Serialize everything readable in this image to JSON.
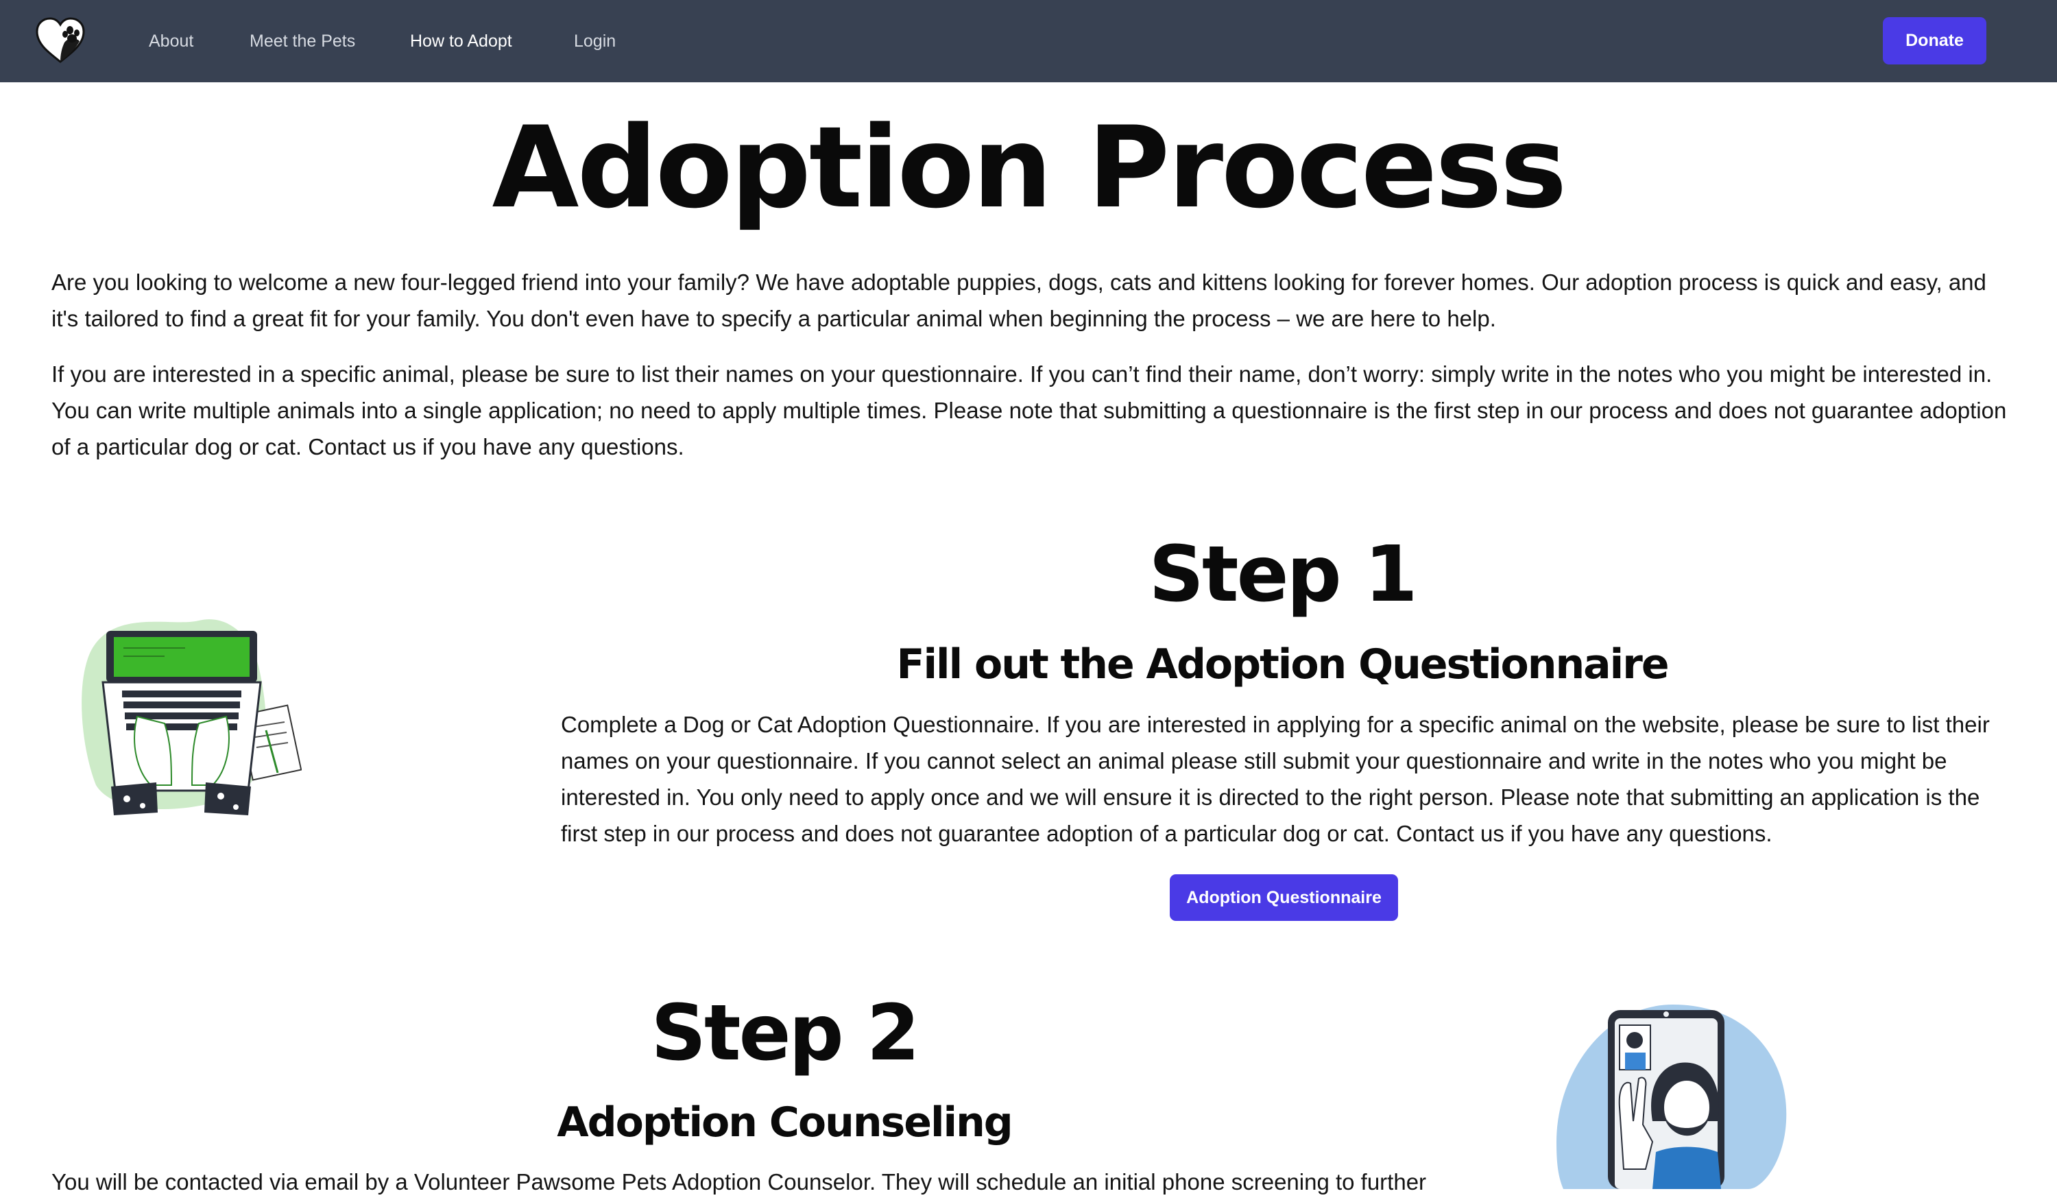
{
  "nav": {
    "logo_icon": "heart-paw-logo-icon",
    "links": [
      "About",
      "Meet the Pets",
      "How to Adopt",
      "Login"
    ],
    "active": "How to Adopt",
    "donate_label": "Donate"
  },
  "page": {
    "title": "Adoption Process",
    "intro_paragraphs": [
      "Are you looking to welcome a new four-legged friend into your family? We have adoptable puppies, dogs, cats and kittens looking for forever homes. Our adoption process is quick and easy, and it's tailored to find a great fit for your family. You don't even have to specify a particular animal when beginning the process – we are here to help.",
      "If you are interested in a specific animal, please be sure to list their names on your questionnaire. If you can’t find their name, don’t worry: simply write in the notes who you might be interested in. You can write multiple animals into a single application; no need to apply multiple times. Please note that submitting a questionnaire is the first step in our process and does not guarantee adoption of a particular dog or cat. Contact us if you have any questions."
    ]
  },
  "steps": [
    {
      "heading": "Step 1",
      "subheading": "Fill out the Adoption Questionnaire",
      "text": "Complete a Dog or Cat Adoption Questionnaire. If you are interested in applying for a specific animal on the website, please be sure to list their names on your questionnaire. If you cannot select an animal please still submit your questionnaire and write in the notes who you might be interested in. You only need to apply once and we will ensure it is directed to the right person. Please note that submitting an application is the first step in our process and does not guarantee adoption of a particular dog or cat. Contact us if you have any questions.",
      "button_label": "Adoption Questionnaire",
      "illustration": "laptop-typing-illustration"
    },
    {
      "heading": "Step 2",
      "subheading": "Adoption Counseling",
      "text": "You will be contacted via email by a Volunteer Pawsome Pets Adoption Counselor. They will schedule an initial phone screening to further",
      "illustration": "phone-video-call-illustration"
    }
  ],
  "colors": {
    "navbar_bg": "#384152",
    "accent": "#4a3ae6",
    "laptop_screen": "#3cb72a",
    "blob_green": "#cdebc8",
    "blob_blue": "#a9cdec"
  }
}
